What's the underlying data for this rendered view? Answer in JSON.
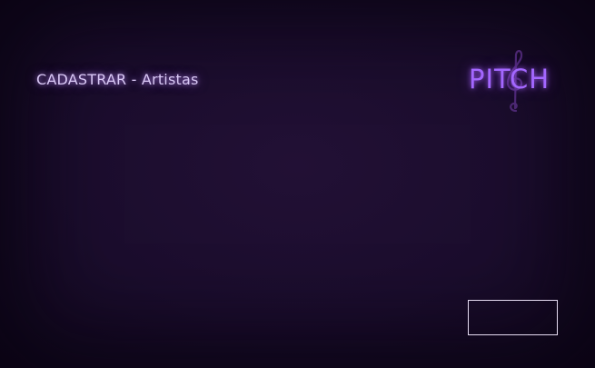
{
  "header": {
    "title": "CADASTRAR - Artistas"
  },
  "logo": {
    "text": "PITCH",
    "icon": "treble-clef-icon",
    "color": "#a367ff"
  },
  "action_button": {
    "label": ""
  },
  "colors": {
    "background": "#1b0d2d",
    "title_text": "#d9c8f5",
    "accent": "#a367ff",
    "button_border": "#e6dcf2"
  }
}
